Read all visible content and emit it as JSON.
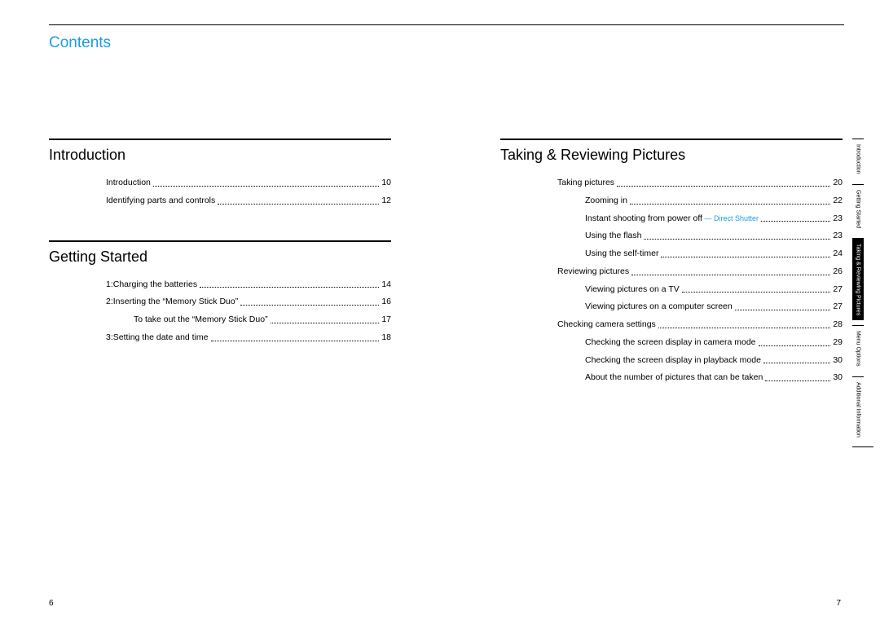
{
  "title": "Contents",
  "page_left": "6",
  "page_right": "7",
  "left_sections": [
    {
      "heading": "Introduction",
      "items": [
        {
          "label": "Introduction",
          "page": "10",
          "level": 1
        },
        {
          "label": "Identifying parts and controls",
          "page": "12",
          "level": 1
        }
      ]
    },
    {
      "heading": "Getting Started",
      "items": [
        {
          "label": "1:Charging the batteries",
          "page": "14",
          "level": 1
        },
        {
          "label": "2:Inserting the “Memory Stick Duo”",
          "page": "16",
          "level": 1
        },
        {
          "label": "To take out the “Memory Stick Duo”",
          "page": "17",
          "level": 2
        },
        {
          "label": "3:Setting the date and time",
          "page": "18",
          "level": 1
        }
      ]
    }
  ],
  "right_sections": [
    {
      "heading": "Taking & Reviewing Pictures",
      "items": [
        {
          "label": "Taking pictures",
          "page": "20",
          "level": 1
        },
        {
          "label": "Zooming in",
          "page": "22",
          "level": 2
        },
        {
          "label": "Instant shooting from power off",
          "feature": " — Direct Shutter",
          "page": "23",
          "level": 2
        },
        {
          "label": "Using the flash",
          "page": "23",
          "level": 2
        },
        {
          "label": "Using the self-timer",
          "page": "24",
          "level": 2
        },
        {
          "label": "Reviewing pictures",
          "page": "26",
          "level": 1
        },
        {
          "label": "Viewing pictures on a TV",
          "page": "27",
          "level": 2
        },
        {
          "label": "Viewing pictures on a computer screen",
          "page": "27",
          "level": 2
        },
        {
          "label": "Checking camera settings",
          "page": "28",
          "level": 1
        },
        {
          "label": "Checking the screen display in camera mode",
          "page": "29",
          "level": 2
        },
        {
          "label": "Checking the screen display in playback mode",
          "page": "30",
          "level": 2
        },
        {
          "label": "About the number of pictures that can be taken",
          "page": "30",
          "level": 2
        }
      ]
    }
  ],
  "tabs": [
    {
      "label": "Introduction",
      "active": false
    },
    {
      "label": "Getting Started",
      "active": false
    },
    {
      "label": "Taking & Reviewing\nPictures",
      "active": true
    },
    {
      "label": "Menu Options",
      "active": false
    },
    {
      "label": "Additional\nInformation",
      "active": false
    }
  ]
}
